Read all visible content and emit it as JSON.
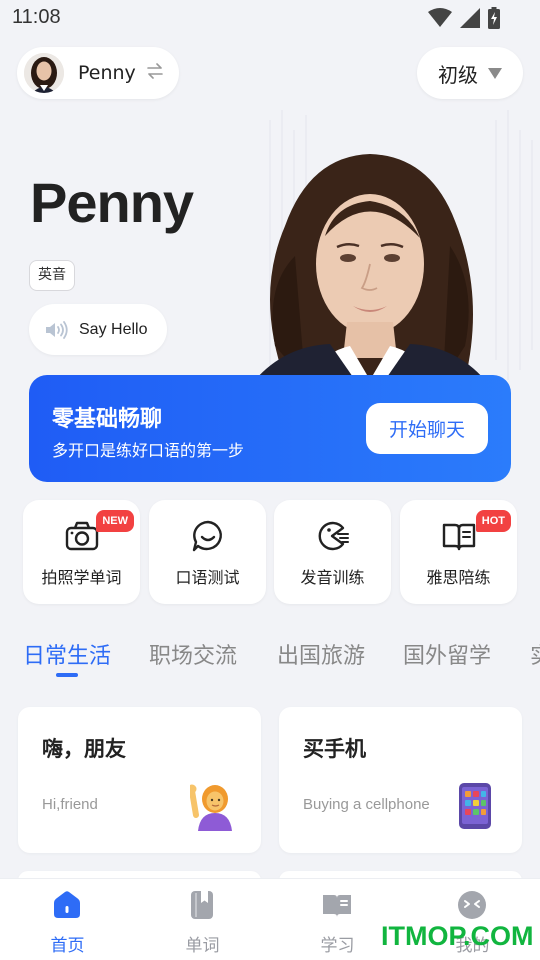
{
  "status_bar": {
    "time": "11:08"
  },
  "header": {
    "tutor_name": "Penny",
    "level": "初级"
  },
  "hero": {
    "name": "Penny",
    "accent": "英音",
    "say_hello": "Say Hello"
  },
  "banner": {
    "title": "零基础畅聊",
    "subtitle": "多开口是练好口语的第一步",
    "button": "开始聊天"
  },
  "features": [
    {
      "label": "拍照学单词",
      "icon": "camera-icon",
      "badge": "NEW"
    },
    {
      "label": "口语测试",
      "icon": "speech-bubble-icon",
      "badge": ""
    },
    {
      "label": "发音训练",
      "icon": "pronunciation-icon",
      "badge": ""
    },
    {
      "label": "雅思陪练",
      "icon": "open-book-icon",
      "badge": "HOT"
    }
  ],
  "category_tabs": [
    "日常生活",
    "职场交流",
    "出国旅游",
    "国外留学",
    "实"
  ],
  "active_tab": "日常生活",
  "scenes": [
    {
      "title": "嗨，朋友",
      "subtitle": "Hi,friend",
      "icon": "waving-woman-icon"
    },
    {
      "title": "买手机",
      "subtitle": "Buying a cellphone",
      "icon": "cellphone-icon"
    }
  ],
  "bottom_nav": [
    {
      "label": "首页",
      "icon": "home-icon",
      "active": true
    },
    {
      "label": "单词",
      "icon": "word-book-icon",
      "active": false
    },
    {
      "label": "学习",
      "icon": "study-book-icon",
      "active": false
    },
    {
      "label": "我的",
      "icon": "profile-face-icon",
      "active": false
    }
  ],
  "watermark": "ITMOP.COM",
  "colors": {
    "accent_blue": "#2e6cf6",
    "badge_red": "#f24141",
    "watermark_green": "#11b53f"
  }
}
